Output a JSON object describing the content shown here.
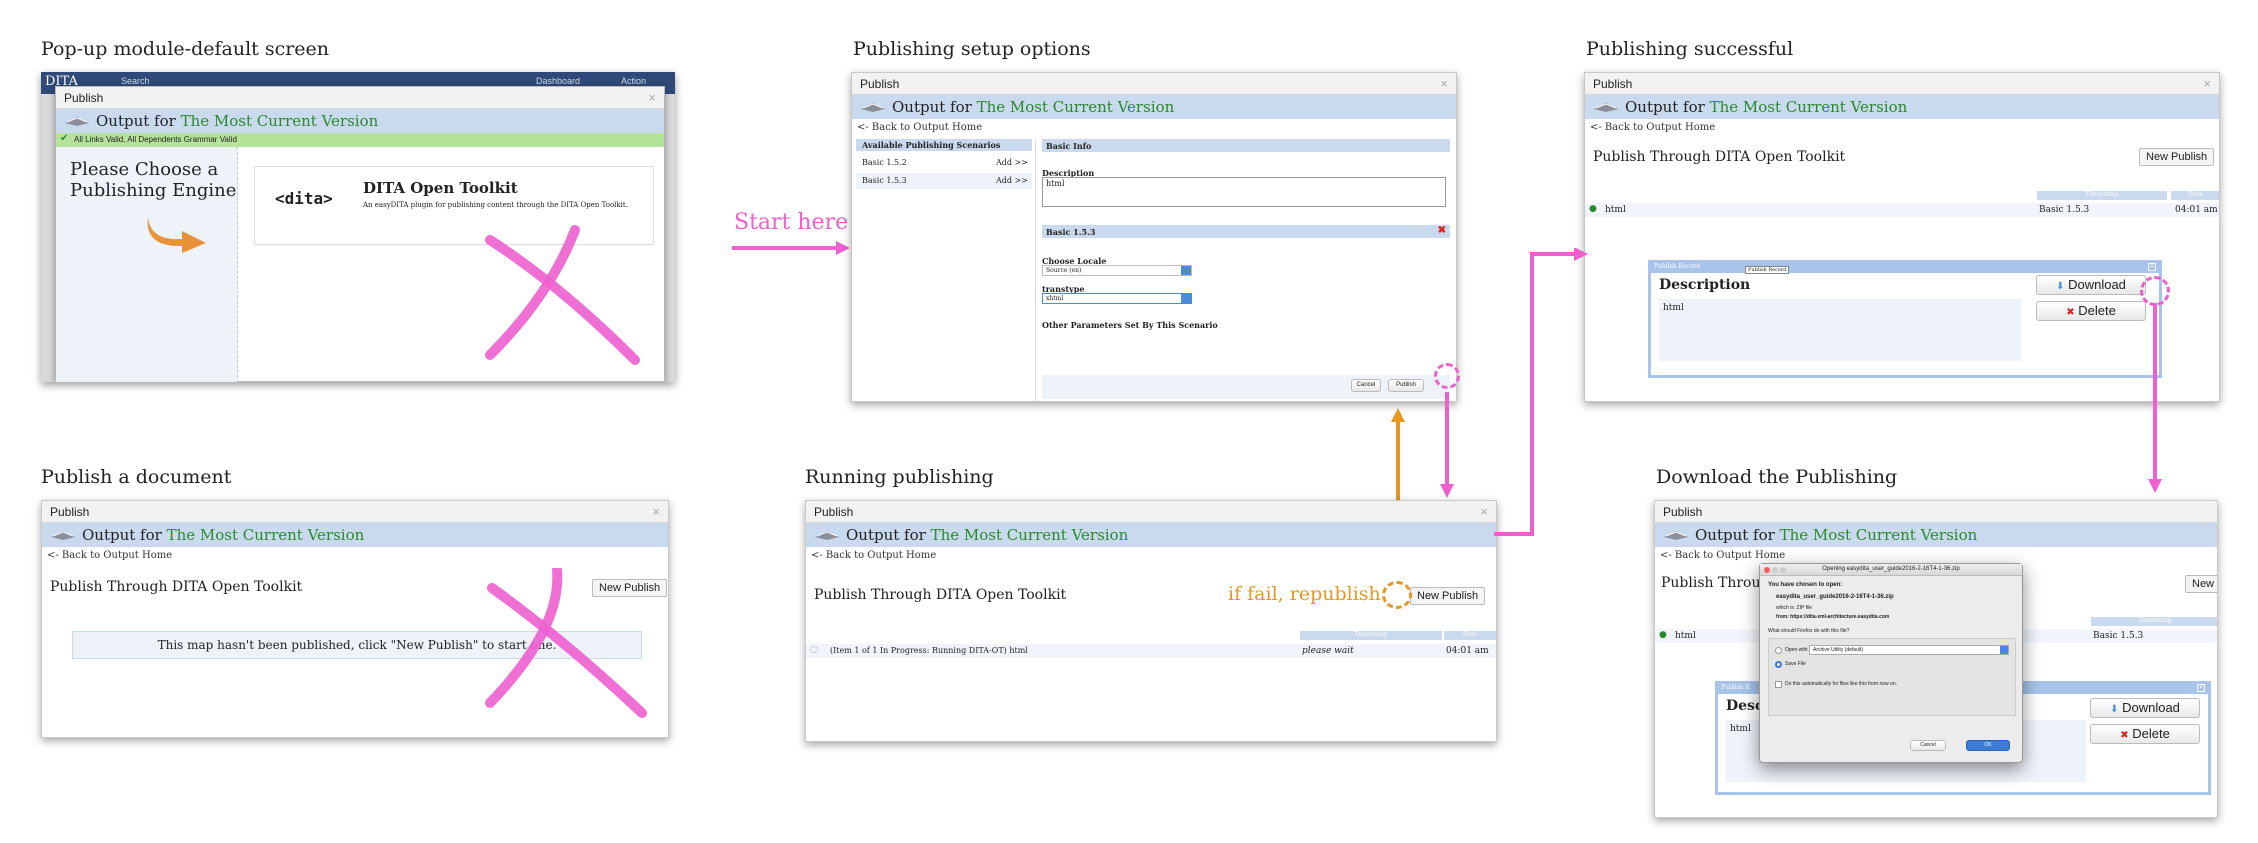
{
  "captions": {
    "popup": "Pop-up module-default screen",
    "setup": "Publishing setup options",
    "success": "Publishing successful",
    "publish_doc": "Publish a document",
    "running": "Running publishing",
    "download": "Download the Publishing"
  },
  "annotations": {
    "start_here": "Start here",
    "if_fail": "if fail, republish"
  },
  "common": {
    "dialog_title": "Publish",
    "close": "×",
    "output_for": "Output for",
    "version": "The Most Current Version",
    "back": "<- Back to Output Home",
    "publish_through": "Publish Through DITA Open Toolkit",
    "new_publish": "New Publish"
  },
  "popup": {
    "bg_app": "DITA",
    "bg_search": "Search",
    "bg_dashboard": "Dashboard",
    "bg_action": "Action",
    "valid_msg": "All Links Valid, All Dependents Grammar Valid",
    "choose_line1": "Please Choose a",
    "choose_line2": "Publishing Engine",
    "engine_logo": "<dita>",
    "engine_title": "DITA Open Toolkit",
    "engine_desc": "An easyDITA plugin for publishing content through the DITA Open Toolkit."
  },
  "setup": {
    "available": "Available Publishing Scenarios",
    "scenarios": [
      {
        "name": "Basic 1.5.2",
        "add": "Add >>"
      },
      {
        "name": "Basic 1.5.3",
        "add": "Add >>"
      }
    ],
    "basic_info": "Basic Info",
    "description_label": "Description",
    "description_value": "html",
    "scenario_title": "Basic 1.5.3",
    "scenario_remove": "✖",
    "locale_label": "Choose Locale",
    "locale_value": "Source (en)",
    "transtype_label": "transtype",
    "transtype_value": "xhtml",
    "other_params": "Other Parameters Set By This Scenario",
    "cancel": "Cancel",
    "publish": "Publish"
  },
  "publish_doc": {
    "empty_msg": "This map hasn't been published, click \"New Publish\" to start one."
  },
  "running": {
    "col_timestamp": "Timestamp",
    "col_date": "Date",
    "item": "(Item 1 of 1 In Progress: Running DITA-OT) html",
    "status": "please wait",
    "time": "04:01 am"
  },
  "success": {
    "col_timestamp": "Timestamp",
    "col_date": "Date",
    "item": "html",
    "version": "Basic 1.5.3",
    "time": "04:01 am",
    "record_title": "Publish Record",
    "record_tooltip": "Publish Record",
    "description": "Description",
    "desc_value": "html",
    "download": "Download",
    "delete": "Delete"
  },
  "download": {
    "ff_title": "Opening easydita_user_guide2016-2-16T4-1-36.zip",
    "chosen": "You have chosen to open:",
    "filename": "easydita_user_guide2016-2-16T4-1-36.zip",
    "which_is": "which is: ZIP file",
    "from": "from: https://dita-xml-architecture.easydita.com",
    "question": "What should Firefox do with this file?",
    "open_with": "Open with",
    "open_with_app": "Archive Utility (default)",
    "save_file": "Save File",
    "auto": "Do this automatically for files like this from now on.",
    "cancel": "Cancel",
    "ok": "OK",
    "row_item": "html",
    "row_version": "Basic 1.5.3",
    "col_timestamp": "Timestamp",
    "new_publish_partial": "New",
    "record_partial": "Publish R",
    "desc_partial": "Desc",
    "desc_value": "html",
    "publish_through_partial": "Publish Through",
    "download": "Download",
    "delete": "Delete"
  },
  "colors": {
    "pink": "#ee5fd0",
    "orange": "#e7961f",
    "header_blue": "#c9d9ee",
    "green": "#2a8a2a"
  }
}
